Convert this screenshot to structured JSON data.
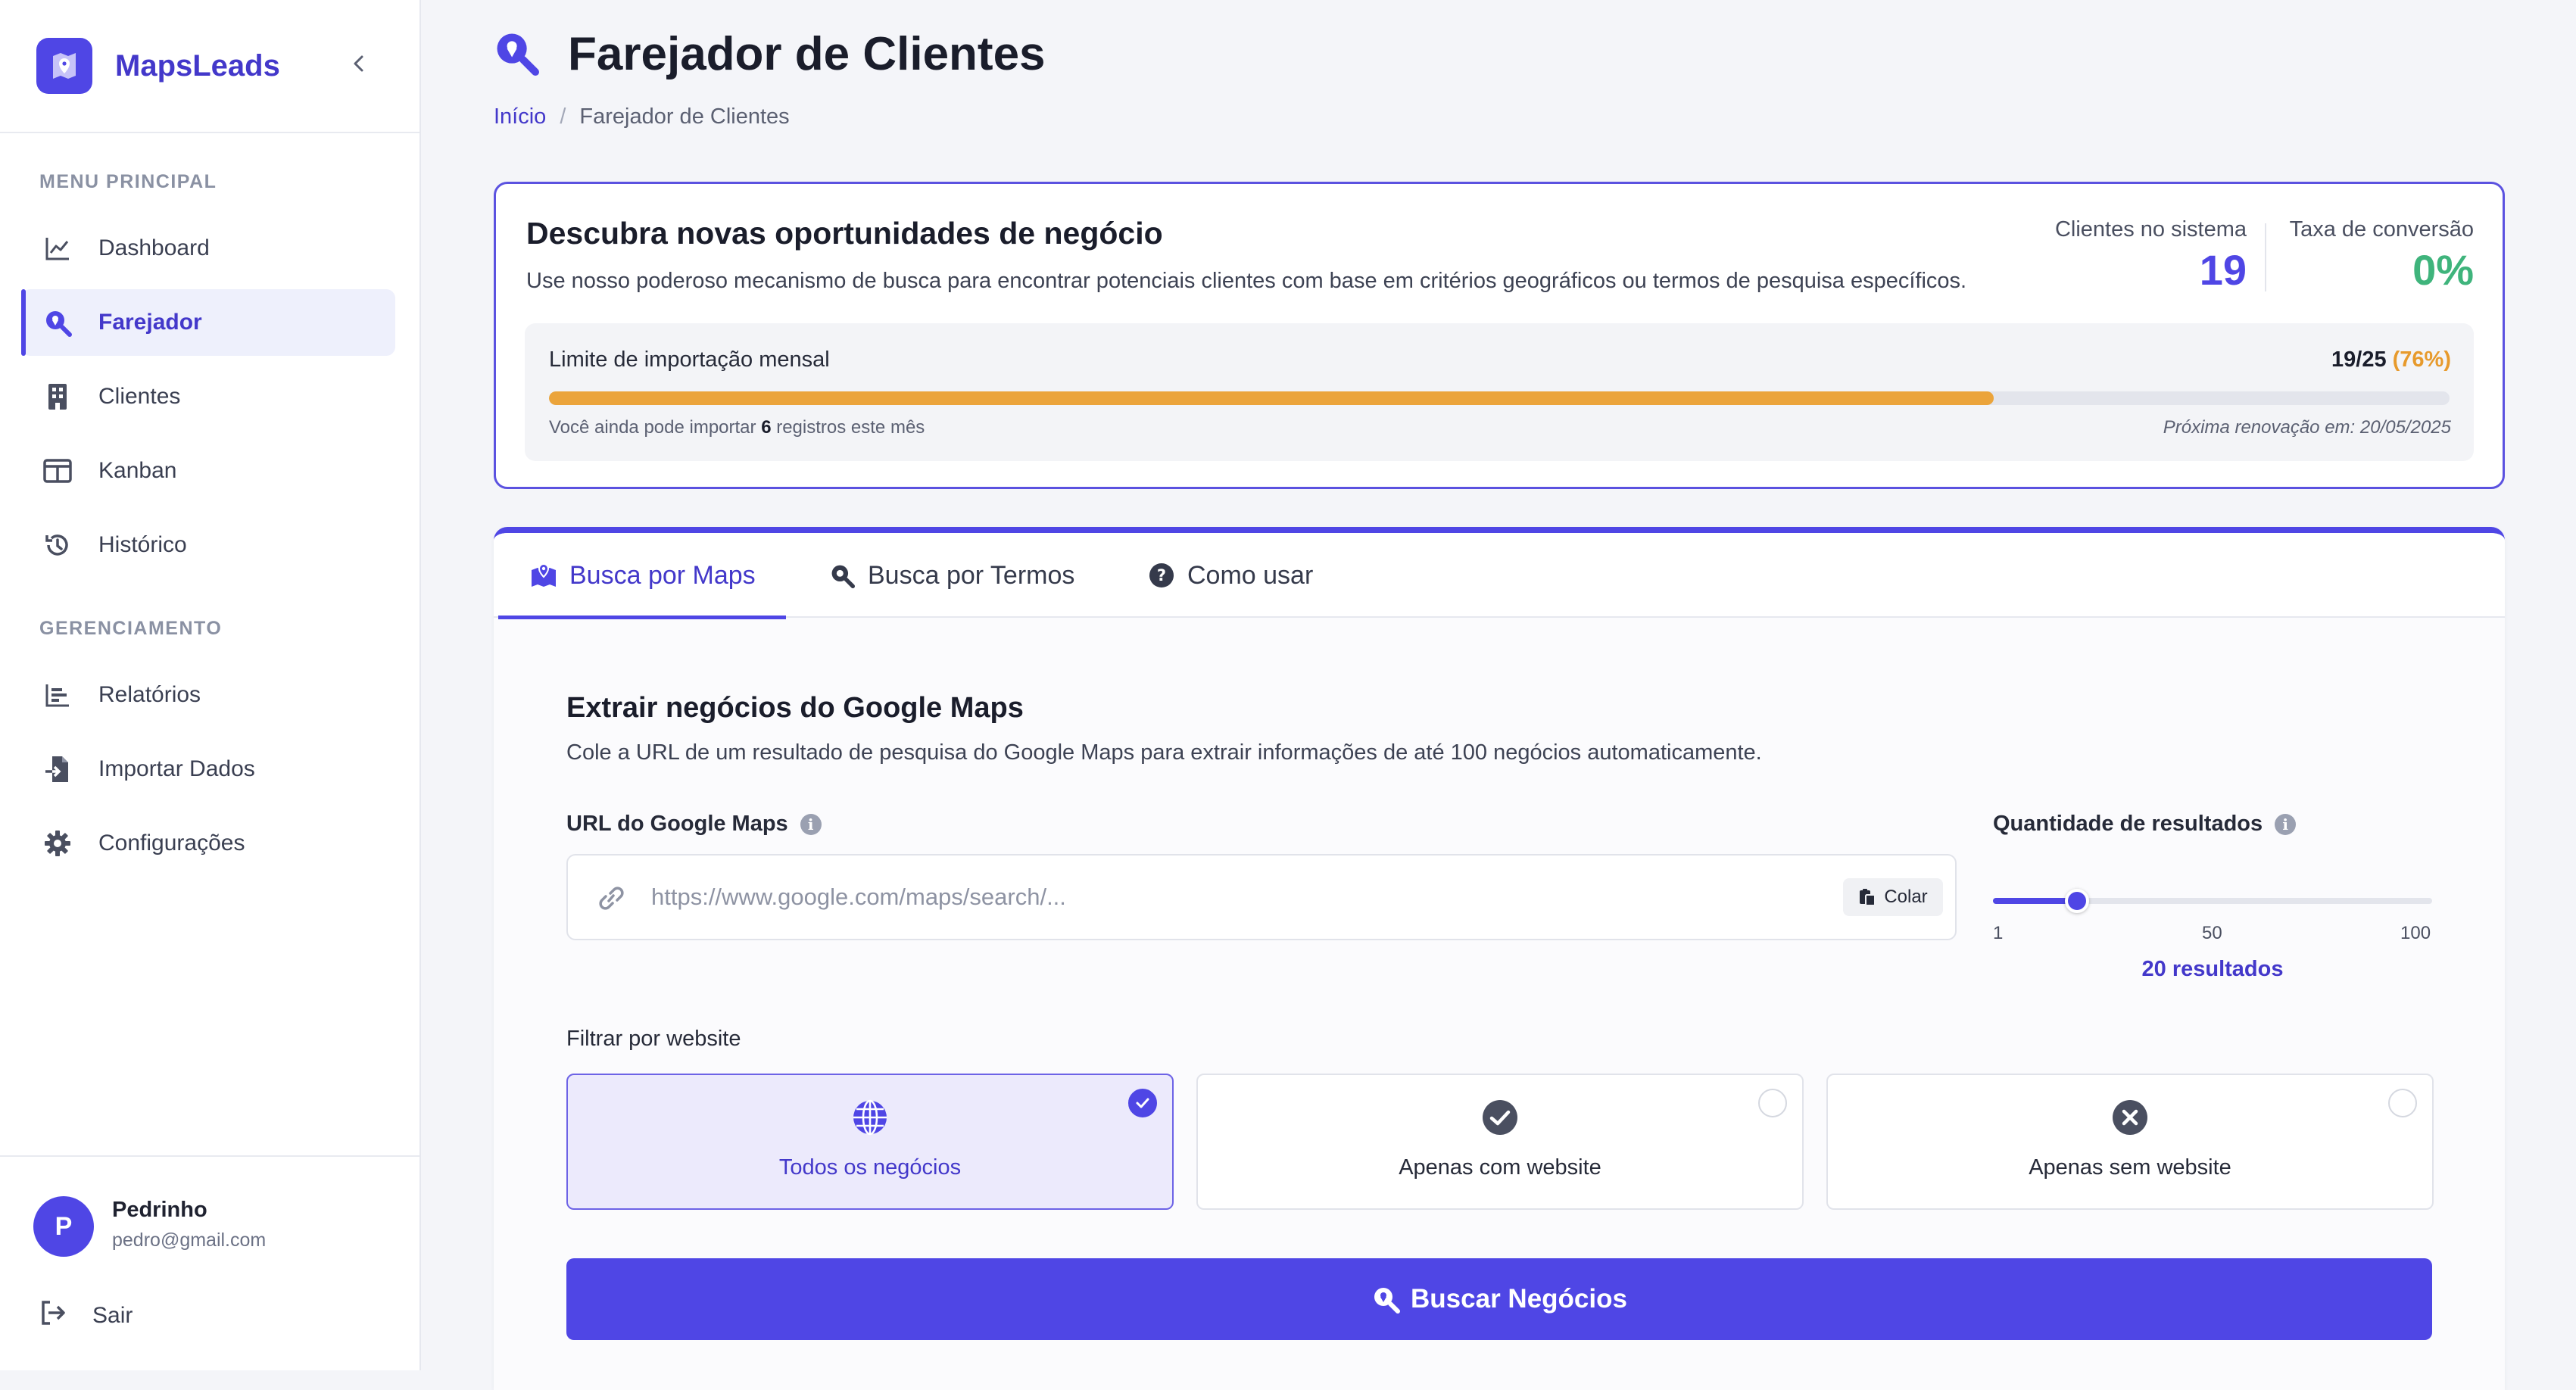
{
  "brand": {
    "name": "MapsLeads"
  },
  "sidebar": {
    "section_main": "MENU PRINCIPAL",
    "section_manage": "GERENCIAMENTO",
    "items": [
      {
        "label": "Dashboard",
        "icon": "chart-line-icon"
      },
      {
        "label": "Farejador",
        "icon": "search-location-icon",
        "active": true
      },
      {
        "label": "Clientes",
        "icon": "building-icon"
      },
      {
        "label": "Kanban",
        "icon": "columns-icon"
      },
      {
        "label": "Histórico",
        "icon": "history-icon"
      },
      {
        "label": "Relatórios",
        "icon": "bar-chart-icon"
      },
      {
        "label": "Importar Dados",
        "icon": "file-import-icon"
      },
      {
        "label": "Configurações",
        "icon": "gear-icon"
      }
    ],
    "user": {
      "initial": "P",
      "name": "Pedrinho",
      "email": "pedro@gmail.com"
    },
    "logout_label": "Sair"
  },
  "header": {
    "title": "Farejador de Clientes",
    "breadcrumb": {
      "home": "Início",
      "separator": "/",
      "current": "Farejador de Clientes"
    }
  },
  "hero": {
    "title": "Descubra novas oportunidades de negócio",
    "description": "Use nosso poderoso mecanismo de busca para encontrar potenciais clientes com base em critérios geográficos ou termos de pesquisa específicos.",
    "stats": {
      "clients_label": "Clientes no sistema",
      "clients_value": "19",
      "conversion_label": "Taxa de conversão",
      "conversion_value": "0%"
    },
    "limit": {
      "title": "Limite de importação mensal",
      "count": "19/25",
      "percent": "(76%)",
      "progress": 0.76,
      "note_prefix": "Você ainda pode importar",
      "note_count": "6",
      "note_suffix": "registros este mês",
      "renewal": "Próxima renovação em: 20/05/2025"
    }
  },
  "tabs": [
    {
      "label": "Busca por Maps",
      "icon": "map-marked-icon",
      "active": true
    },
    {
      "label": "Busca por Termos",
      "icon": "search-icon"
    },
    {
      "label": "Como usar",
      "icon": "question-circle-icon"
    }
  ],
  "maps_form": {
    "title": "Extrair negócios do Google Maps",
    "description": "Cole a URL de um resultado de pesquisa do Google Maps para extrair informações de até 100 negócios automaticamente.",
    "url_label": "URL do Google Maps",
    "url_placeholder": "https://www.google.com/maps/search/...",
    "url_value": "",
    "paste_label": "Colar",
    "quantity_label": "Quantidade de resultados",
    "slider": {
      "min": 1,
      "mid": 50,
      "max": 100,
      "value": 20,
      "min_label": "1",
      "mid_label": "50",
      "max_label": "100"
    },
    "quantity_text": "20 resultados",
    "filter_label": "Filtrar por website",
    "filter_options": [
      {
        "label": "Todos os negócios",
        "icon": "globe-icon",
        "selected": true
      },
      {
        "label": "Apenas com website",
        "icon": "check-circle-icon",
        "selected": false
      },
      {
        "label": "Apenas sem website",
        "icon": "times-circle-icon",
        "selected": false
      }
    ],
    "submit_label": "Buscar Negócios"
  },
  "colors": {
    "accent": "#4f46e5",
    "accent_dark": "#4338ca",
    "warning": "#eba43b",
    "success": "#3fb47c"
  }
}
